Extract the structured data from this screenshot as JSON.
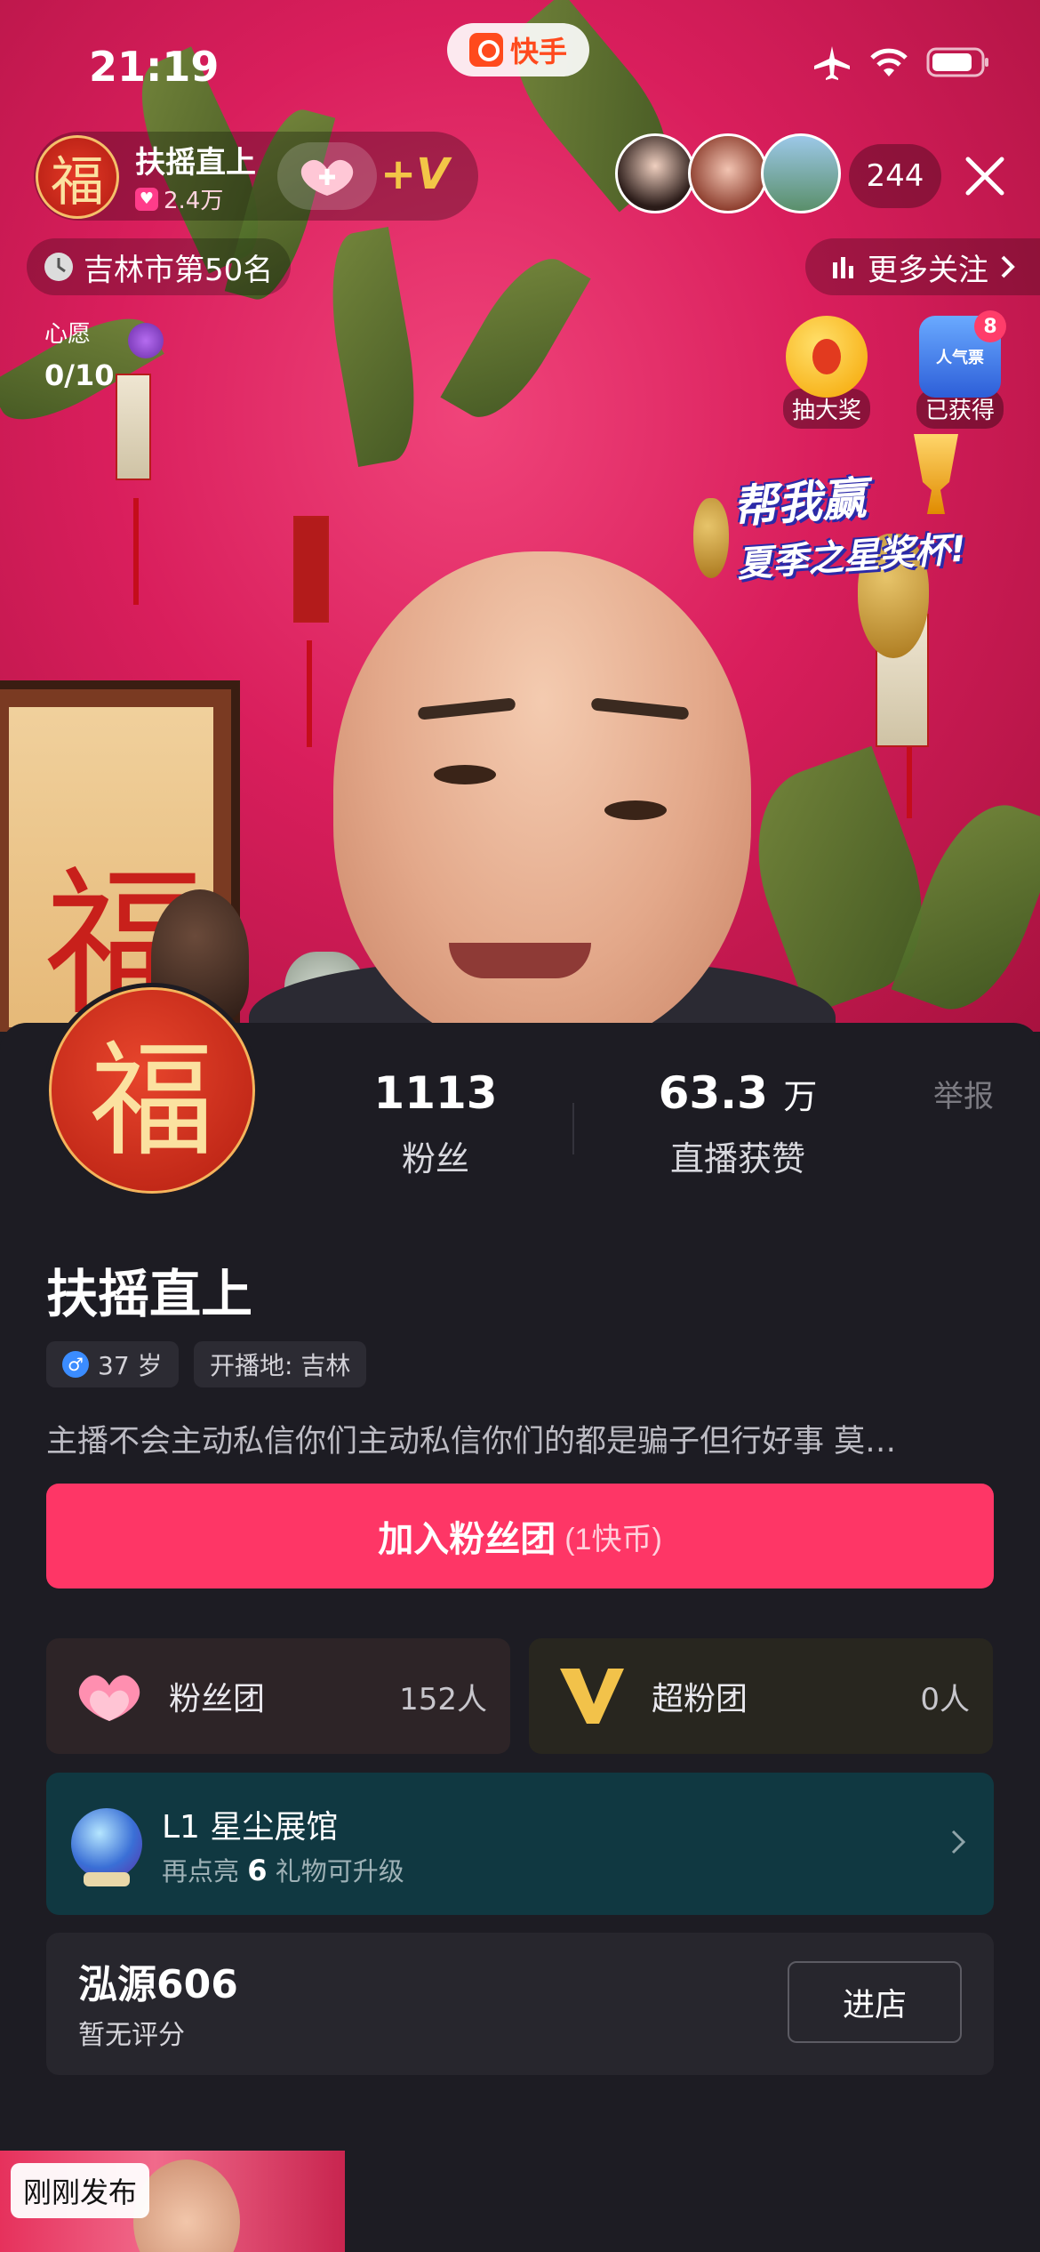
{
  "status_bar": {
    "time": "21:19",
    "app_name": "快手"
  },
  "host": {
    "avatar_char": "福",
    "name": "扶摇直上",
    "likes": "2.4万"
  },
  "viewers": {
    "count": "244"
  },
  "location_rank": "吉林市第50名",
  "more_follow": "更多关注",
  "wish": {
    "label": "心愿",
    "progress": "0/10"
  },
  "lottery_label": "抽大奖",
  "obtained": {
    "label": "已获得",
    "badge_text": "人气票",
    "count": "8"
  },
  "promo": {
    "line1": "帮我赢",
    "line2": "夏季之星奖杯!"
  },
  "profile": {
    "avatar_char": "福",
    "fans_value": "1113",
    "fans_label": "粉丝",
    "likes_value": "63.3",
    "likes_unit": "万",
    "likes_label": "直播获赞",
    "report": "举报",
    "name": "扶摇直上",
    "gender_icon": "♂",
    "age": "37 岁",
    "broadcast_location": "开播地: 吉林",
    "bio": "主播不会主动私信你们主动私信你们的都是骗子但行好事 莫…"
  },
  "join_button": {
    "label": "加入粉丝团",
    "cost": "(1快币)"
  },
  "fan_club": {
    "title": "粉丝团",
    "count": "152人"
  },
  "super_fan_club": {
    "title": "超粉团",
    "count": "0人"
  },
  "gallery": {
    "title": "L1 星尘展馆",
    "sub_prefix": "再点亮",
    "sub_num": "6",
    "sub_suffix": "礼物可升级"
  },
  "shop": {
    "name": "泓源606",
    "rating": "暂无评分",
    "enter": "进店"
  },
  "recent_post": {
    "tag": "刚刚发布"
  },
  "colors": {
    "accent": "#fe3666",
    "sheet_bg": "#1d1c23",
    "card_bg": "#27262d",
    "gallery_bg": "#103841"
  },
  "icons": [
    "airplane-icon",
    "wifi-icon",
    "battery-icon",
    "close-icon",
    "clock-icon",
    "bars-icon",
    "chevron-right-icon",
    "heart-icon",
    "v-icon",
    "globe-icon"
  ]
}
